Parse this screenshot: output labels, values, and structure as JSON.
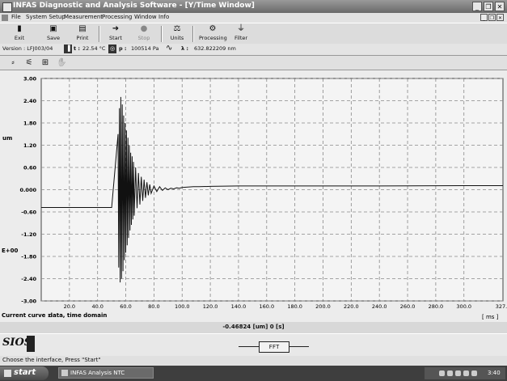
{
  "window": {
    "title": "INFAS Diagnostic and Analysis Software - [Y/Time Window]",
    "controls": [
      "_",
      "❐",
      "✕"
    ],
    "mdi_controls": [
      "_",
      "❐",
      "✕"
    ]
  },
  "menu": [
    "File",
    "System Setup",
    "Measurement",
    "Processing",
    "Window",
    "Info"
  ],
  "toolbar": {
    "exit": "Exit",
    "save": "Save",
    "print": "Print",
    "start": "Start",
    "stop": "Stop",
    "units": "Units",
    "processing": "Processing",
    "filter": "Filter"
  },
  "info": {
    "version": "Version : LFJ003/04",
    "temp_label": "t :",
    "temp_value": "22.54 °C",
    "pressure_label": "p :",
    "pressure_value": "100514 Pa",
    "lambda_label": "λ :",
    "lambda_value": "632.822209 nm"
  },
  "chart_data": {
    "type": "line",
    "ylabel": "um",
    "y_side_label": "E+00",
    "ylim": [
      -3.0,
      3.0
    ],
    "y_ticks": [
      "3.00",
      "2.40",
      "1.80",
      "1.20",
      "0.60",
      "0.000",
      "-0.60",
      "-1.20",
      "-1.80",
      "-2.40",
      "-3.00"
    ],
    "xlim": [
      0,
      327.7
    ],
    "x_ticks": [
      "20.0",
      "40.0",
      "60.0",
      "80.0",
      "100.0",
      "120.0",
      "140.0",
      "160.0",
      "180.0",
      "200.0",
      "220.0",
      "240.0",
      "260.0",
      "280.0",
      "300.0",
      "327.7"
    ],
    "x_unit": "[ ms ]",
    "grid": true,
    "series": [
      {
        "x": [
          0,
          50,
          54.5,
          55.0,
          55.5,
          56.0,
          56.5,
          57.0,
          57.5,
          58.0,
          58.5,
          59.0,
          59.5,
          60.0,
          60.5,
          61.0,
          61.5,
          62.0,
          62.5,
          63.0,
          63.5,
          64.0,
          64.5,
          65.0,
          65.5,
          66.0,
          67,
          68,
          69,
          70,
          71,
          72,
          73,
          74,
          75,
          76,
          77,
          78,
          80,
          82,
          84,
          86,
          88,
          90,
          92,
          94,
          96,
          98,
          100,
          104,
          108,
          112,
          120,
          140,
          180,
          240,
          300,
          327.7
        ],
        "y": [
          -0.48,
          -0.48,
          1.5,
          -2.1,
          2.2,
          -2.5,
          2.5,
          -2.4,
          2.3,
          -2.2,
          2.0,
          -1.9,
          1.8,
          -1.7,
          1.6,
          -1.5,
          1.4,
          -1.3,
          1.2,
          -1.1,
          1.0,
          -0.95,
          0.9,
          -0.8,
          0.75,
          -0.7,
          0.6,
          -0.5,
          0.45,
          -0.4,
          0.35,
          -0.3,
          0.27,
          -0.22,
          0.2,
          -0.15,
          0.14,
          -0.1,
          0.1,
          -0.05,
          0.08,
          -0.02,
          0.05,
          0.0,
          0.04,
          0.02,
          0.05,
          0.04,
          0.06,
          0.07,
          0.08,
          0.08,
          0.09,
          0.1,
          0.1,
          0.1,
          0.11,
          0.11
        ]
      }
    ]
  },
  "current_curve": {
    "label": "Current curve :",
    "value": "data, time domain"
  },
  "readout": "-0.46824  [um]  0 [s]",
  "logo": "SIOS",
  "fft_label": "FFT",
  "status": "Choose the interface, Press \"Start\"",
  "taskbar": {
    "start": "start",
    "task": "INFAS Analysis NTC",
    "clock": "3:40"
  }
}
